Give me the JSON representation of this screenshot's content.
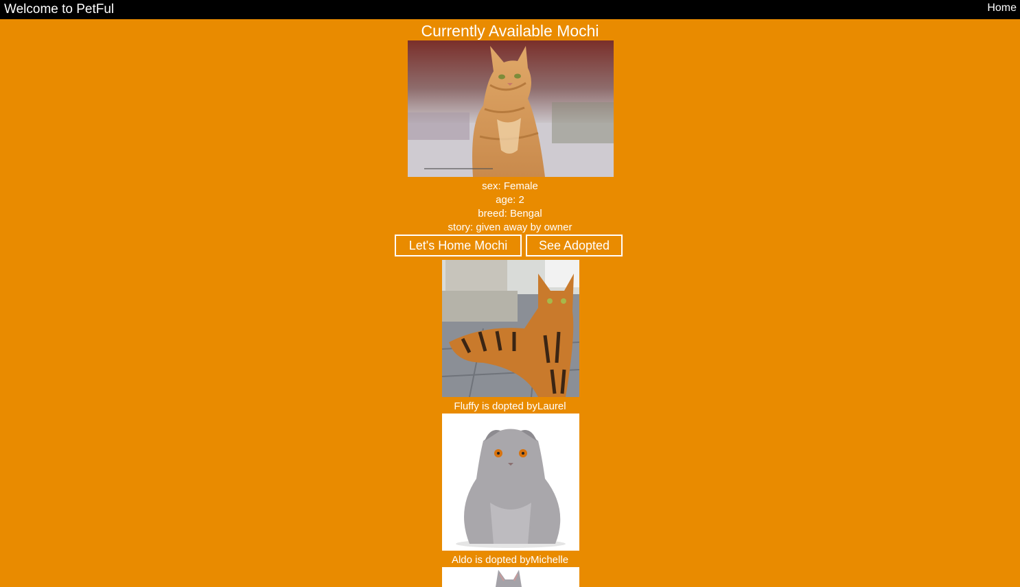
{
  "header": {
    "title": "Welcome to PetFul",
    "home_label": "Home"
  },
  "featured": {
    "heading": "Currently Available Mochi",
    "photo_subject": "orange tabby cat",
    "sex": "sex: Female",
    "age": "age: 2",
    "breed": "breed: Bengal",
    "story": "story: given away by owner",
    "adopt_button": "Let's Home Mochi",
    "adopted_button": "See Adopted"
  },
  "adopted": [
    {
      "photo_subject": "bengal cat",
      "caption": "Fluffy is dopted byLaurel"
    },
    {
      "photo_subject": "grey scottish fold cat",
      "caption": "Aldo is dopted byMichelle"
    },
    {
      "photo_subject": "grey cat"
    }
  ],
  "colors": {
    "background": "#e98b00",
    "topbar": "#000000",
    "text": "#ffffff"
  }
}
